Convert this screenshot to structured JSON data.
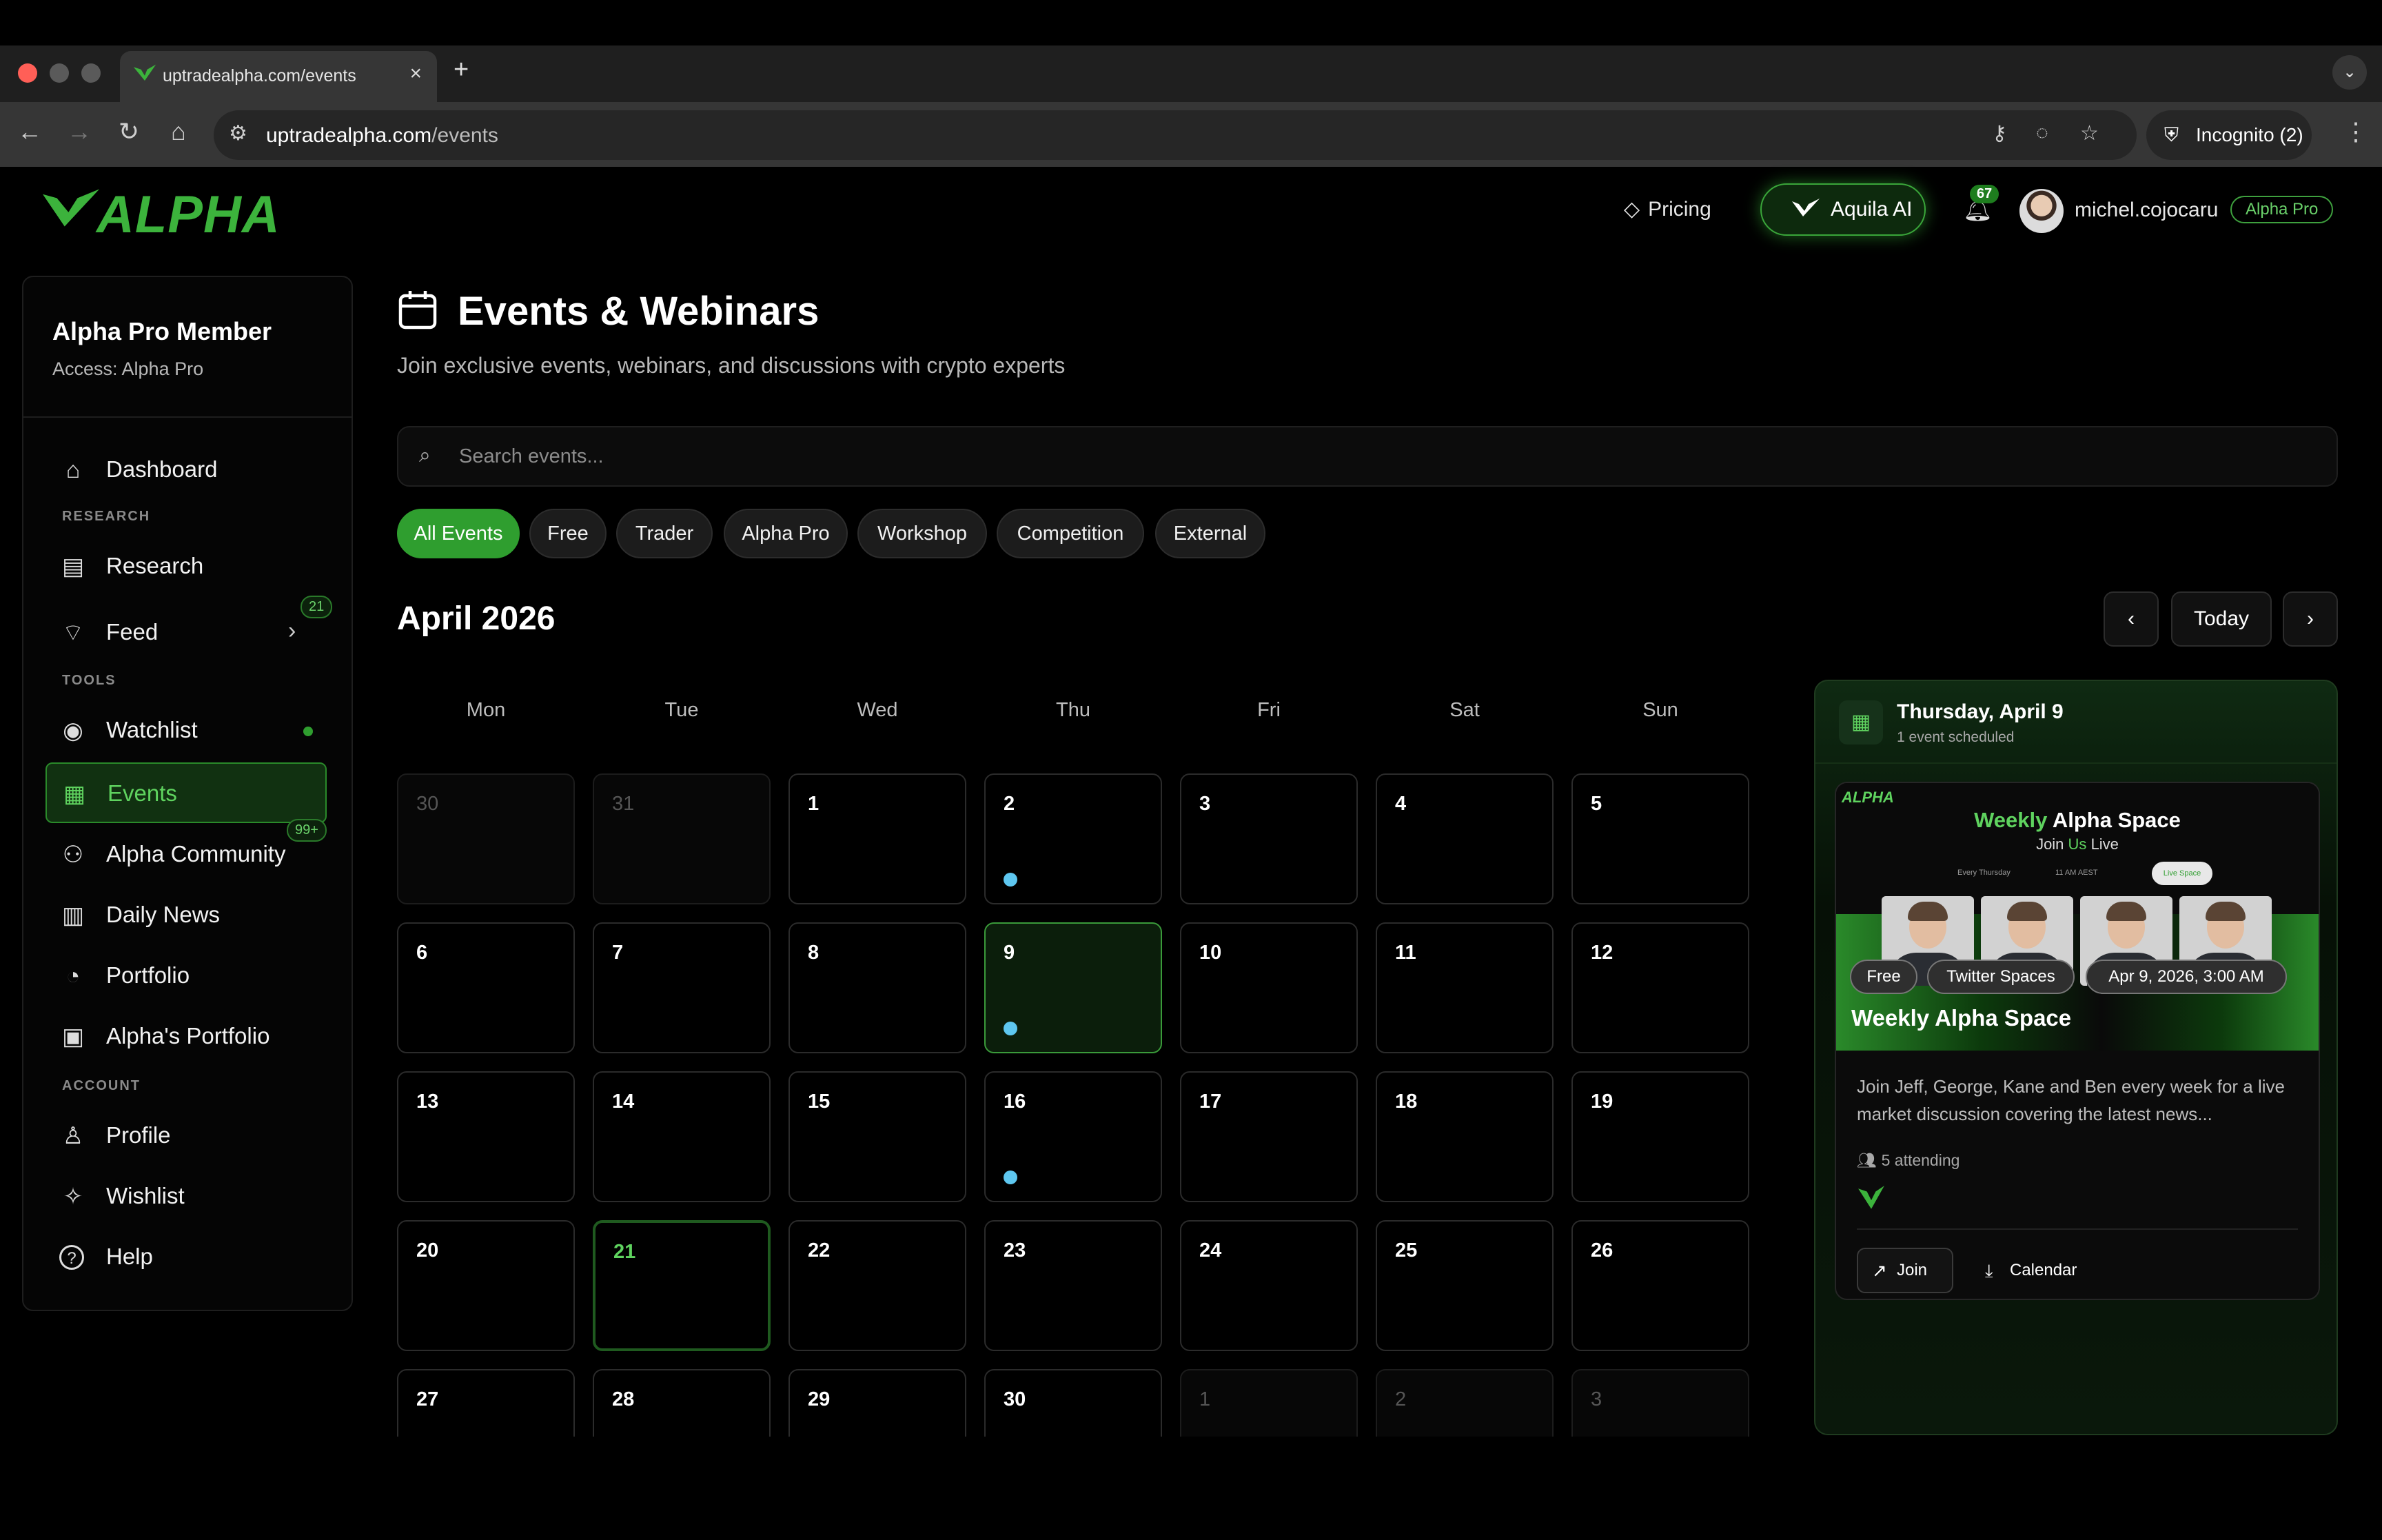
{
  "browser": {
    "tab_title": "uptradealpha.com/events",
    "url_host": "uptradealpha.com",
    "url_path": "/events",
    "incognito_label": "Incognito (2)"
  },
  "header": {
    "logo_text": "ALPHA",
    "pricing_label": "Pricing",
    "aquila_label": "Aquila AI",
    "notification_count": "67",
    "username": "michel.cojocaru",
    "plan_badge": "Alpha Pro"
  },
  "sidebar": {
    "member_title": "Alpha Pro Member",
    "access_text": "Access: Alpha Pro",
    "sections": {
      "research": "RESEARCH",
      "tools": "TOOLS",
      "account": "ACCOUNT"
    },
    "items": [
      {
        "label": "Dashboard",
        "icon": "home-icon"
      },
      {
        "label": "Research",
        "icon": "document-icon"
      },
      {
        "label": "Feed",
        "icon": "rss-icon",
        "badge": "21"
      },
      {
        "label": "Watchlist",
        "icon": "eye-scan-icon"
      },
      {
        "label": "Events",
        "icon": "calendar-icon",
        "active": true
      },
      {
        "label": "Alpha Community",
        "icon": "users-icon",
        "badge": "99+"
      },
      {
        "label": "Daily News",
        "icon": "newspaper-icon"
      },
      {
        "label": "Portfolio",
        "icon": "pie-chart-icon"
      },
      {
        "label": "Alpha's Portfolio",
        "icon": "briefcase-icon"
      },
      {
        "label": "Profile",
        "icon": "user-icon"
      },
      {
        "label": "Wishlist",
        "icon": "lightbulb-icon"
      },
      {
        "label": "Help",
        "icon": "help-circle-icon"
      }
    ]
  },
  "main": {
    "title": "Events & Webinars",
    "subtitle": "Join exclusive events, webinars, and discussions with crypto experts",
    "search_placeholder": "Search events...",
    "filters": [
      "All Events",
      "Free",
      "Trader",
      "Alpha Pro",
      "Workshop",
      "Competition",
      "External"
    ],
    "active_filter": "All Events",
    "month_label": "April 2026",
    "today_label": "Today",
    "weekdays": [
      "Mon",
      "Tue",
      "Wed",
      "Thu",
      "Fri",
      "Sat",
      "Sun"
    ],
    "days": [
      {
        "d": "30",
        "muted": true
      },
      {
        "d": "31",
        "muted": true
      },
      {
        "d": "1"
      },
      {
        "d": "2",
        "event": true
      },
      {
        "d": "3"
      },
      {
        "d": "4"
      },
      {
        "d": "5"
      },
      {
        "d": "6"
      },
      {
        "d": "7"
      },
      {
        "d": "8"
      },
      {
        "d": "9",
        "event": true,
        "selected": true
      },
      {
        "d": "10"
      },
      {
        "d": "11"
      },
      {
        "d": "12"
      },
      {
        "d": "13"
      },
      {
        "d": "14"
      },
      {
        "d": "15"
      },
      {
        "d": "16",
        "event": true
      },
      {
        "d": "17"
      },
      {
        "d": "18"
      },
      {
        "d": "19"
      },
      {
        "d": "20"
      },
      {
        "d": "21",
        "today": true
      },
      {
        "d": "22"
      },
      {
        "d": "23"
      },
      {
        "d": "24"
      },
      {
        "d": "25"
      },
      {
        "d": "26"
      },
      {
        "d": "27"
      },
      {
        "d": "28"
      },
      {
        "d": "29"
      },
      {
        "d": "30"
      },
      {
        "d": "1",
        "muted": true
      },
      {
        "d": "2",
        "muted": true
      },
      {
        "d": "3",
        "muted": true
      }
    ]
  },
  "panel": {
    "date_title": "Thursday, April 9",
    "scheduled_text": "1 event scheduled",
    "event": {
      "banner_logo": "ALPHA",
      "banner_title_green": "Weekly",
      "banner_title_rest": "Alpha Space",
      "banner_sub_a": "Join",
      "banner_sub_green": "Us",
      "banner_sub_b": "Live",
      "banner_meta_1": "Every Thursday",
      "banner_meta_2": "11 AM AEST",
      "banner_live": "Live Space",
      "tags": [
        "Free",
        "Twitter Spaces",
        "Apr 9, 2026, 3:00 AM"
      ],
      "title": "Weekly Alpha Space",
      "description": "Join Jeff, George, Kane and Ben every week for a live market discussion covering the latest news...",
      "attending": "5 attending",
      "join_label": "Join",
      "calendar_label": "Calendar"
    }
  },
  "colors": {
    "accent": "#2f9e2f",
    "accent_text": "#5fd35f",
    "event_dot": "#5ec7f0"
  }
}
